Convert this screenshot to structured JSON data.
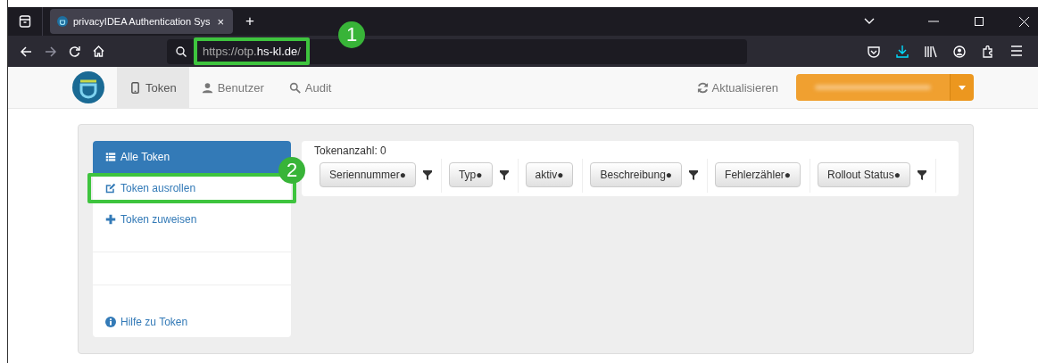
{
  "browser": {
    "tab_title": "privacyIDEA Authentication Sys",
    "tab_close": "×",
    "new_tab": "+",
    "url_prefix": "https://otp.",
    "url_host": "hs-kl.de",
    "url_suffix": "/"
  },
  "annotations": [
    {
      "label": "1"
    },
    {
      "label": "2"
    }
  ],
  "navbar": {
    "tabs": [
      {
        "label": "Token",
        "selected": true
      },
      {
        "label": "Benutzer",
        "selected": false
      },
      {
        "label": "Audit",
        "selected": false
      }
    ],
    "refresh": "Aktualisieren"
  },
  "sidebar": {
    "items": [
      {
        "label": "Alle Token",
        "selected": true,
        "highlighted": false
      },
      {
        "label": "Token ausrollen",
        "selected": false,
        "highlighted": true
      },
      {
        "label": "Token zuweisen",
        "selected": false,
        "highlighted": false
      }
    ],
    "help": "Hilfe zu Token"
  },
  "table": {
    "count": "Tokenanzahl: 0",
    "columns": [
      {
        "label": "Seriennummer●",
        "filter": true
      },
      {
        "label": "Typ●",
        "filter": true
      },
      {
        "label": "aktiv●",
        "filter": false
      },
      {
        "label": "Beschreibung●",
        "filter": true
      },
      {
        "label": "Fehlerzähler●",
        "filter": false
      },
      {
        "label": "Rollout Status●",
        "filter": true
      }
    ]
  }
}
